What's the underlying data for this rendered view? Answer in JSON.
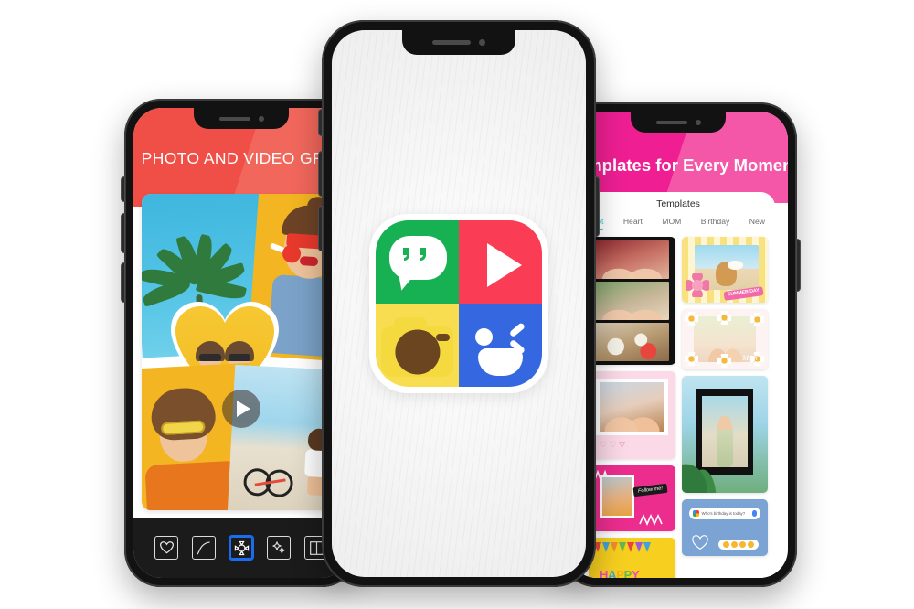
{
  "page": {
    "background": "#ffffff",
    "description": "Three iPhone mockups showing a photo collage app: left phone collage editor, center phone app icon, right phone templates gallery"
  },
  "phones": {
    "left": {
      "name": "collage-editor-phone",
      "header_title": "PHOTO AND VIDEO GRID",
      "header_color": "#ef4f46",
      "toolbar": {
        "items": [
          {
            "icon": "heart-shape-icon",
            "label": "Heart",
            "active": false
          },
          {
            "icon": "curve-shape-icon",
            "label": "Curve",
            "active": false
          },
          {
            "icon": "sticker-shape-icon",
            "label": "Shape",
            "active": true
          },
          {
            "icon": "sparkle-stars-icon",
            "label": "Effects",
            "active": false
          },
          {
            "icon": "split-layout-icon",
            "label": "Layout",
            "active": false
          }
        ],
        "active_color": "#1a6df0",
        "background": "#1b1b1b"
      },
      "collage": {
        "play_overlay": "play-icon",
        "cells": [
          {
            "name": "sky-palm-photo"
          },
          {
            "name": "lollipop-girl-photo"
          },
          {
            "name": "heart-friends-photo"
          },
          {
            "name": "yellow-sunglasses-girl-photo"
          },
          {
            "name": "beach-bicycle-video"
          }
        ]
      }
    },
    "center": {
      "name": "app-icon-phone",
      "screen_background": "#f0f0f0",
      "app_icon": {
        "name": "photo-grid-app-icon",
        "quadrants": [
          {
            "name": "speech-bubble-quadrant",
            "color": "#17b053",
            "glyph": "speech-bubble-quotes-icon"
          },
          {
            "name": "video-play-quadrant",
            "color": "#fa3c55",
            "glyph": "play-icon"
          },
          {
            "name": "camera-quadrant",
            "color": "#f7dd4f",
            "glyph": "camera-icon"
          },
          {
            "name": "wink-face-quadrant",
            "color": "#3567e0",
            "glyph": "wink-face-icon"
          }
        ]
      }
    },
    "right": {
      "name": "templates-gallery-phone",
      "header_title": "Templates for Every Moment",
      "header_color": "#ef1f93",
      "sheet": {
        "back_icon": "back-chevron-icon",
        "title": "Templates",
        "tabs": [
          {
            "label": "Hot",
            "active": true
          },
          {
            "label": "Heart",
            "active": false
          },
          {
            "label": "MOM",
            "active": false
          },
          {
            "label": "Birthday",
            "active": false
          },
          {
            "label": "New",
            "active": false
          }
        ],
        "active_tab_color": "#23c9e0",
        "templates": {
          "left_column": [
            {
              "name": "filmstrip-template",
              "style": "film"
            },
            {
              "name": "polaroid-pink-template",
              "style": "polaroid",
              "icons": "♡ ♡ ▽"
            },
            {
              "name": "pink-follow-template",
              "style": "pink",
              "tag": "Follow me!"
            },
            {
              "name": "happy-birthday-template",
              "style": "birthday",
              "text": "HAPPY BIRTHDAY"
            }
          ],
          "right_column": [
            {
              "name": "summer-beach-template",
              "style": "beach",
              "tag": "SUMMER DAY"
            },
            {
              "name": "mom-daisy-template",
              "style": "mom",
              "word": "Mom"
            },
            {
              "name": "palm-beach-frame-template",
              "style": "palm"
            },
            {
              "name": "birthday-chat-template",
              "style": "chat",
              "query": "Who's birthday is today?"
            }
          ]
        }
      }
    }
  }
}
